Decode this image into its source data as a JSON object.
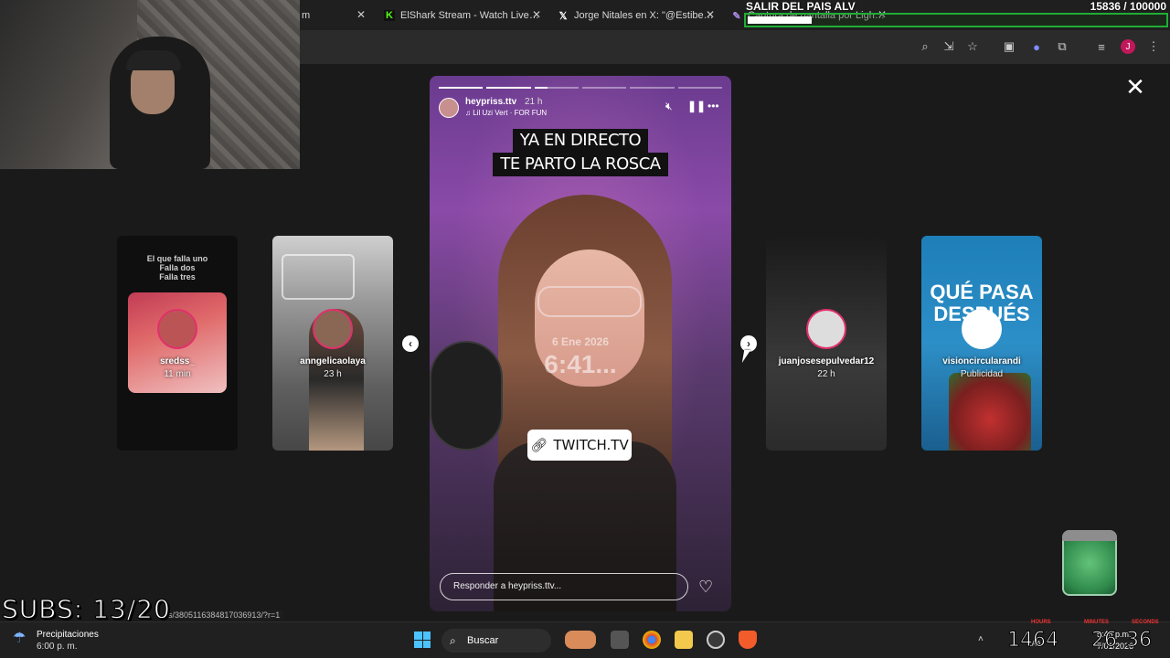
{
  "browser": {
    "tabs": [
      {
        "label": "m",
        "favicon": "generic"
      },
      {
        "label": "ElShark Stream - Watch Live on",
        "favicon": "kick-icon"
      },
      {
        "label": "Jorge Nitales en X: \"@EstibenU",
        "favicon": "x-icon"
      },
      {
        "label": "Captura de pantalla por Lightshot",
        "favicon": "feather-icon"
      }
    ],
    "toolbar_icons": [
      "zoom-icon",
      "install-icon",
      "star-icon",
      "pip-icon",
      "extension-blob-icon",
      "puzzle-icon",
      "media-icon",
      "profile-avatar-icon",
      "kebab-menu-icon"
    ],
    "profile_initial": "J"
  },
  "stream_goal": {
    "title": "SALIR DEL PAIS ALV",
    "count": "15836 / 100000",
    "progress_fraction": 0.158,
    "bar_color": "#1fae34"
  },
  "story_viewer": {
    "close_icon": "close-icon",
    "side_stories": [
      {
        "user": "sredss_",
        "age": "11 min",
        "caption": [
          "El que falla uno",
          "Falla dos",
          "Falla tres"
        ]
      },
      {
        "user": "anngelicaolaya",
        "age": "23 h"
      },
      {
        "user": "juanjosesepulvedar12",
        "age": "22 h"
      },
      {
        "user": "visioncircularandi",
        "age": "Publicidad",
        "headline": "QUÉ PASA DESPUÉS"
      }
    ],
    "main": {
      "user": "heypriss.ttv",
      "time": "21 h",
      "song": "Lil Uzi Vert · FOR FUN",
      "caption_line1": "YA EN DIRECTO",
      "caption_line2": "TE PARTO LA ROSCA",
      "lock_date": "6 Ene 2026",
      "lock_time": "6:41...",
      "link_label": "TWITCH.TV",
      "reply_placeholder": "Responder a heypriss.ttv...",
      "progress_segments": [
        1,
        1,
        0.3,
        0,
        0,
        0
      ]
    }
  },
  "overlay": {
    "subs": "SUBS: 13/20",
    "url_status": "s/3805116384817036913/?r=1"
  },
  "taskbar": {
    "weather_title": "Precipitaciones",
    "weather_sub": "6:00 p. m.",
    "search_label": "Buscar",
    "clock_time": "5:45 p.m.",
    "clock_date": "7/01/2026",
    "counters": {
      "hours_label": "HOURS",
      "minutes_label": "MINUTES",
      "seconds_label": "SECONDS",
      "hours": "1464",
      "minutes": "26",
      "seconds": "36"
    },
    "tray_lang": "LAA"
  }
}
